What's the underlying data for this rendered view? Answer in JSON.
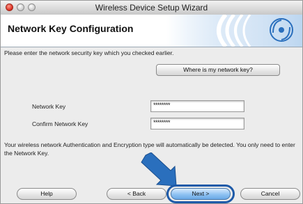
{
  "window": {
    "title": "Wireless Device Setup Wizard"
  },
  "banner": {
    "title": "Network Key Configuration",
    "logo_icon": "wireless-waves-icon",
    "accent": "#2a6fbd"
  },
  "content": {
    "instruction": "Please enter the network security key which you checked earlier.",
    "where_button": "Where is my network key?",
    "network_key": {
      "label": "Network Key",
      "value": "********"
    },
    "confirm_key": {
      "label": "Confirm Network Key",
      "value": "********"
    },
    "description": "Your wireless network Authentication and Encryption type will automatically be detected. You only need to enter the Network Key."
  },
  "footer": {
    "help": "Help",
    "back": "< Back",
    "next": "Next >",
    "cancel": "Cancel"
  },
  "colors": {
    "highlight_ring": "#1e5aa8",
    "arrow": "#2a6fbd"
  }
}
